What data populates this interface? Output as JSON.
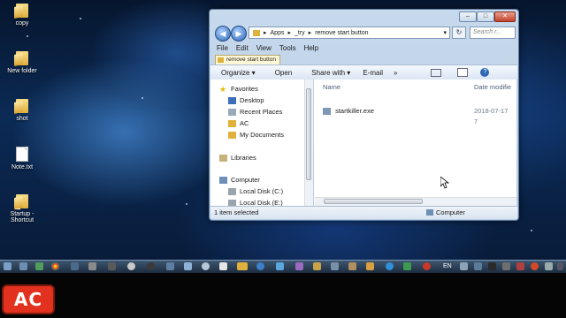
{
  "desktop": {
    "icons": [
      {
        "label": "copy"
      },
      {
        "label": "New folder"
      },
      {
        "label": "shot"
      },
      {
        "label": "Note.txt"
      },
      {
        "label": "Startup -\nShortcut"
      }
    ]
  },
  "explorer": {
    "address": {
      "crumbs": [
        "Apps",
        "_try",
        "remove start button"
      ],
      "search_placeholder": "Search r..."
    },
    "menu": [
      "File",
      "Edit",
      "View",
      "Tools",
      "Help"
    ],
    "breadcrumb_tab": "remove start button",
    "toolbar": {
      "organize": "Organize ▾",
      "open": "Open",
      "share_with": "Share with ▾",
      "email": "E-mail",
      "more": "»"
    },
    "nav": {
      "favorites": "Favorites",
      "desktop": "Desktop",
      "recent": "Recent Places",
      "ac": "AC",
      "documents": "My Documents",
      "libraries": "Libraries",
      "computer": "Computer",
      "disk_c": "Local Disk (C:)",
      "disk_e": "Local Disk (E:)"
    },
    "columns": {
      "name": "Name",
      "date": "Date modifie"
    },
    "files": [
      {
        "name": "startkiller.exe",
        "date": "2018-07-17 7"
      }
    ],
    "status": {
      "count": "1 item selected",
      "location": "Computer"
    }
  },
  "taskbar": {
    "lang": "EN"
  },
  "logo": {
    "text": "AC"
  },
  "colors": {
    "logo_red": "#e2321f",
    "window_frame": "#b9cde4"
  }
}
